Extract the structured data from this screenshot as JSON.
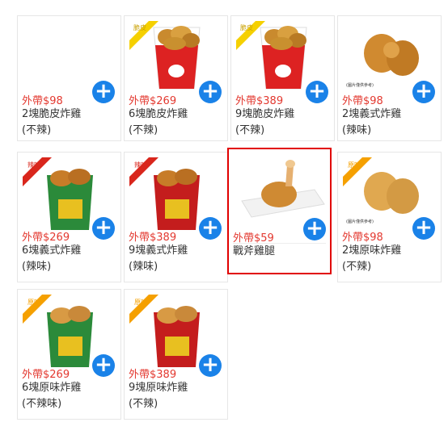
{
  "products": [
    {
      "price": "外帶$98",
      "name1": "2塊脆皮炸雞",
      "name2": "(不辣)",
      "ribbon": "none",
      "image": "blank"
    },
    {
      "price": "外帶$269",
      "name1": "6塊脆皮炸雞",
      "name2": "(不辣)",
      "ribbon": "yellow",
      "ribbon_text": "脆皮",
      "image": "bucket-crispy"
    },
    {
      "price": "外帶$389",
      "name1": "9塊脆皮炸雞",
      "name2": "(不辣)",
      "ribbon": "yellow",
      "ribbon_text": "脆皮",
      "image": "bucket-crispy"
    },
    {
      "price": "外帶$98",
      "name1": "2塊義式炸雞",
      "name2": "(辣味)",
      "ribbon": "none",
      "caption": "(圖片僅供參考)",
      "image": "two-pieces"
    },
    {
      "price": "外帶$269",
      "name1": "6塊義式炸雞",
      "name2": "(辣味)",
      "ribbon": "red",
      "ribbon_text": "辣味",
      "image": "bucket-green"
    },
    {
      "price": "外帶$389",
      "name1": "9塊義式炸雞",
      "name2": "(辣味)",
      "ribbon": "red",
      "ribbon_text": "辣味",
      "image": "bucket-red"
    },
    {
      "price": "外帶$59",
      "name1": "戰斧雞腿",
      "name2": "",
      "ribbon": "none",
      "image": "drumstick",
      "selected": true
    },
    {
      "price": "外帶$98",
      "name1": "2塊原味炸雞",
      "name2": "(不辣)",
      "ribbon": "orange",
      "ribbon_text": "原味",
      "caption": "(圖片僅供參考)",
      "image": "two-pieces"
    },
    {
      "price": "外帶$269",
      "name1": "6塊原味炸雞",
      "name2": "(不辣味)",
      "ribbon": "orange",
      "ribbon_text": "原味",
      "image": "bucket-green"
    },
    {
      "price": "外帶$389",
      "name1": "9塊原味炸雞",
      "name2": "(不辣)",
      "ribbon": "orange",
      "ribbon_text": "原味",
      "image": "bucket-red"
    }
  ],
  "add_button_symbol": "+",
  "colors": {
    "price": "#e3382f",
    "add_button": "#1a82e8",
    "selected_border": "#e10000",
    "ribbon_yellow": "#f5d000",
    "ribbon_red": "#d9261c",
    "ribbon_orange": "#f5a000"
  }
}
